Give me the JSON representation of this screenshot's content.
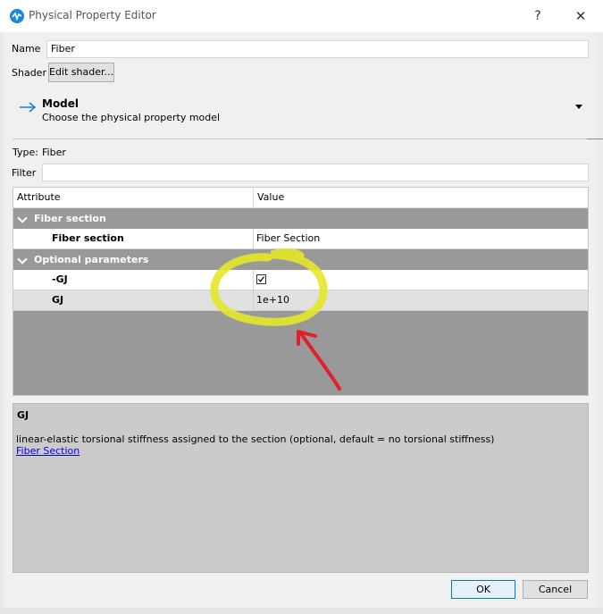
{
  "window": {
    "title": "Physical Property Editor",
    "help_label": "?",
    "close_label": "✕"
  },
  "form": {
    "name_label": "Name",
    "name_value": "Fiber",
    "shader_label": "Shader",
    "shader_button": "Edit shader...",
    "model_title": "Model",
    "model_subtitle": "Choose the physical property model",
    "type_label": "Type:",
    "type_value": "Fiber",
    "filter_label": "Filter",
    "filter_value": ""
  },
  "table": {
    "columns": [
      "Attribute",
      "Value"
    ],
    "sections": [
      {
        "title": "Fiber section",
        "rows": [
          {
            "name": "Fiber section",
            "value": "Fiber Section"
          }
        ]
      },
      {
        "title": "Optional parameters",
        "rows": [
          {
            "name": "-GJ",
            "value": "",
            "checked": true
          },
          {
            "name": "GJ",
            "value": "1e+10"
          }
        ]
      }
    ]
  },
  "description": {
    "title": "GJ",
    "text": "linear-elastic torsional stiffness assigned to the section (optional, default = no torsional stiffness)",
    "link": "Fiber Section"
  },
  "buttons": {
    "ok": "OK",
    "cancel": "Cancel"
  },
  "annotation_colors": {
    "highlight": "#e6e62a",
    "arrow": "#e0202a"
  },
  "icons": [
    "app-logo-icon",
    "arrow-right-icon",
    "chevron-down-icon",
    "checkbox-icon"
  ]
}
